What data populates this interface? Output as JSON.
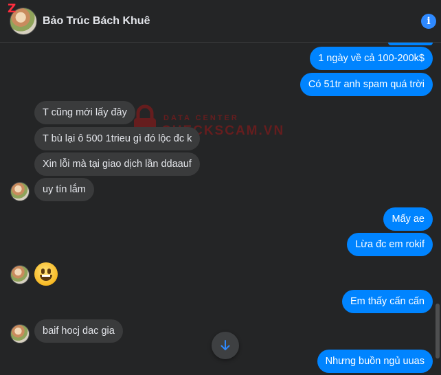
{
  "header": {
    "contact_name": "Bảo Trúc Bách Khuê",
    "badge": "Z",
    "info_icon": "info-icon"
  },
  "watermark": {
    "top": "DATA CENTER",
    "main": "CHECKSCAM.VN"
  },
  "messages": {
    "out1": "1 ngày về cả 100-200k$",
    "out2": "Có 51tr anh spam quá trời",
    "in1": "T cũng mới lấy đây",
    "in2": "T bù lại ô 500 1trieu gì đó lộc đc k",
    "in3": "Xin lỗi mà tại giao dịch lần ddaauf",
    "in4": "uy tín lắm",
    "out3": "Mấy ae",
    "out4": "Lừa đc em rokif",
    "in5_emoji": "grinning-face",
    "out5": "Em thấy cấn cấn",
    "in6": "baif hocj dac gia",
    "out6": "Nhưng buồn ngủ uuas"
  },
  "colors": {
    "outgoing": "#0084ff",
    "incoming": "#3a3b3c",
    "background": "#242526"
  }
}
